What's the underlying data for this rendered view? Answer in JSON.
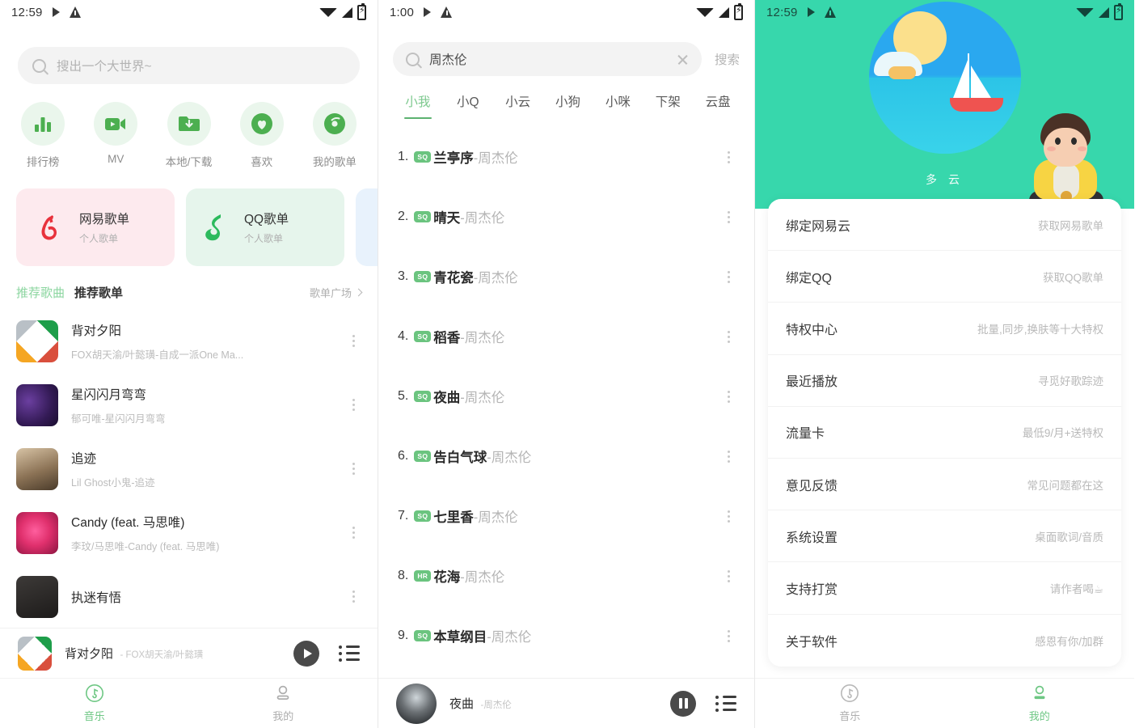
{
  "panel1": {
    "status": {
      "time": "12:59"
    },
    "search": {
      "placeholder": "搜出一个大世界~",
      "icon": "search-icon"
    },
    "quick_actions": [
      {
        "label": "排行榜",
        "icon": "chart-bars-icon"
      },
      {
        "label": "MV",
        "icon": "video-camera-icon"
      },
      {
        "label": "本地/下载",
        "icon": "folder-download-icon"
      },
      {
        "label": "喜欢",
        "icon": "heart-icon"
      },
      {
        "label": "我的歌单",
        "icon": "disc-icon"
      }
    ],
    "cards": [
      {
        "title": "网易歌单",
        "subtitle": "个人歌单",
        "icon": "netease-logo-icon",
        "color": "#fdeaee"
      },
      {
        "title": "QQ歌单",
        "subtitle": "个人歌单",
        "icon": "qq-music-note-icon",
        "color": "#e6f5ec"
      },
      {
        "title": "",
        "subtitle": "",
        "icon": "",
        "color": "#e8f2fc"
      }
    ],
    "section": {
      "tab_active": "推荐歌曲",
      "tab_inactive": "推荐歌单",
      "more": "歌单广场"
    },
    "songs": [
      {
        "title": "背对夕阳",
        "artist": "FOX胡天渝/叶懿璜-自成一派One Ma..."
      },
      {
        "title": "星闪闪月弯弯",
        "artist": "郁可唯-星闪闪月弯弯"
      },
      {
        "title": "追迹",
        "artist": "Lil Ghost小鬼-追迹"
      },
      {
        "title": "Candy (feat. 马思唯)",
        "artist": "李玟/马思唯-Candy (feat. 马思唯)"
      },
      {
        "title": "执迷有悟",
        "artist": ""
      }
    ],
    "mini_player": {
      "title": "背对夕阳",
      "artist": "- FOX胡天渝/叶懿璜",
      "play_state": "play",
      "playlist_icon": "playlist-icon"
    },
    "tabbar": [
      {
        "label": "音乐",
        "icon": "music-disc-icon",
        "active": true
      },
      {
        "label": "我的",
        "icon": "person-icon",
        "active": false
      }
    ]
  },
  "panel2": {
    "status": {
      "time": "1:00"
    },
    "search": {
      "value": "周杰伦",
      "clear_icon": "close-icon",
      "button": "搜索",
      "icon": "search-icon"
    },
    "tabs": [
      {
        "label": "小我",
        "active": true
      },
      {
        "label": "小Q",
        "active": false
      },
      {
        "label": "小云",
        "active": false
      },
      {
        "label": "小狗",
        "active": false
      },
      {
        "label": "小咪",
        "active": false
      },
      {
        "label": "下架",
        "active": false
      },
      {
        "label": "云盘",
        "active": false
      }
    ],
    "results": [
      {
        "num": "1.",
        "badge": "SQ",
        "title": "兰亭序",
        "artist": "-周杰伦"
      },
      {
        "num": "2.",
        "badge": "SQ",
        "title": "晴天",
        "artist": "-周杰伦"
      },
      {
        "num": "3.",
        "badge": "SQ",
        "title": "青花瓷",
        "artist": "-周杰伦"
      },
      {
        "num": "4.",
        "badge": "SQ",
        "title": "稻香",
        "artist": "-周杰伦"
      },
      {
        "num": "5.",
        "badge": "SQ",
        "title": "夜曲",
        "artist": "-周杰伦"
      },
      {
        "num": "6.",
        "badge": "SQ",
        "title": "告白气球",
        "artist": "-周杰伦"
      },
      {
        "num": "7.",
        "badge": "SQ",
        "title": "七里香",
        "artist": "-周杰伦"
      },
      {
        "num": "8.",
        "badge": "HR",
        "title": "花海",
        "artist": "-周杰伦"
      },
      {
        "num": "9.",
        "badge": "SQ",
        "title": "本草纲目",
        "artist": "-周杰伦"
      }
    ],
    "mini_player": {
      "title": "夜曲",
      "artist": "-周杰伦",
      "play_state": "pause",
      "playlist_icon": "playlist-icon"
    }
  },
  "panel3": {
    "status": {
      "time": "12:59"
    },
    "weather": {
      "label": "多 云",
      "illustration": "sailboat-sun-sea-icon",
      "avatar": "seated-boy-avatar",
      "bg_color": "#37d7ac"
    },
    "settings": [
      {
        "label": "绑定网易云",
        "value": "获取网易歌单"
      },
      {
        "label": "绑定QQ",
        "value": "获取QQ歌单"
      },
      {
        "label": "特权中心",
        "value": "批量,同步,换肤等十大特权"
      },
      {
        "label": "最近播放",
        "value": "寻觅好歌踪迹"
      },
      {
        "label": "流量卡",
        "value": "最低9/月+送特权"
      },
      {
        "label": "意见反馈",
        "value": "常见问题都在这"
      },
      {
        "label": "系统设置",
        "value": "桌面歌词/音质"
      },
      {
        "label": "支持打赏",
        "value": "请作者喝☕"
      },
      {
        "label": "关于软件",
        "value": "感恩有你/加群"
      }
    ],
    "tabbar": [
      {
        "label": "音乐",
        "icon": "music-disc-icon",
        "active": false
      },
      {
        "label": "我的",
        "icon": "person-icon",
        "active": true
      }
    ]
  }
}
